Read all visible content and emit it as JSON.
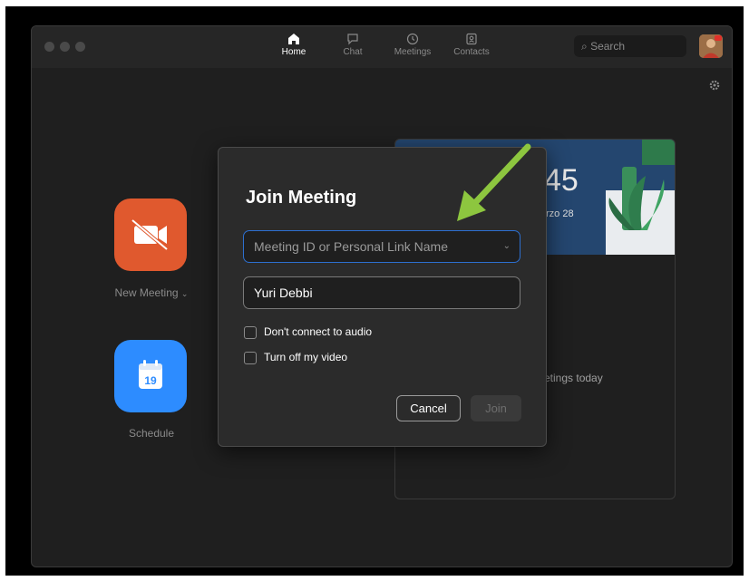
{
  "nav": {
    "tabs": [
      {
        "label": "Home",
        "icon": "home-icon",
        "active": true
      },
      {
        "label": "Chat",
        "icon": "chat-icon",
        "active": false
      },
      {
        "label": "Meetings",
        "icon": "clock-icon",
        "active": false
      },
      {
        "label": "Contacts",
        "icon": "contacts-icon",
        "active": false
      }
    ],
    "search_label": "Search"
  },
  "home": {
    "new_meeting_label": "New Meeting",
    "schedule_label": "Schedule",
    "calendar_day": "19"
  },
  "card": {
    "time": "45",
    "date": "rzo 28",
    "empty_text": "etings today"
  },
  "dialog": {
    "title": "Join Meeting",
    "meeting_id_placeholder": "Meeting ID or Personal Link Name",
    "name_value": "Yuri Debbi",
    "option_audio": "Don't connect to audio",
    "option_video": "Turn off my video",
    "cancel_label": "Cancel",
    "join_label": "Join"
  },
  "colors": {
    "new_meeting_tile": "#e0592e",
    "schedule_tile": "#2d8cff",
    "focus_border": "#2d6fd0",
    "annotation_arrow": "#8dc63f"
  }
}
